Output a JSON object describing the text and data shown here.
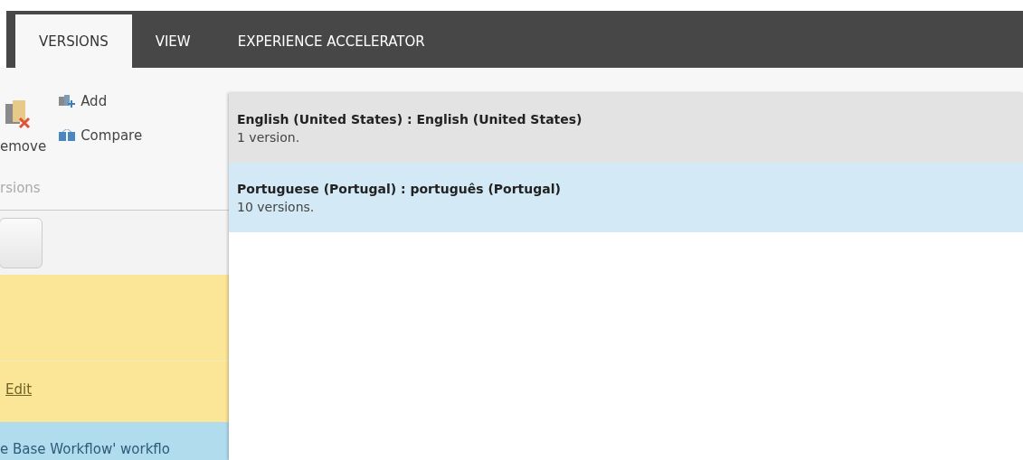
{
  "tabs": [
    {
      "label": "VERSIONS",
      "selected": true
    },
    {
      "label": "VIEW",
      "selected": false
    },
    {
      "label": "EXPERIENCE ACCELERATOR",
      "selected": false
    }
  ],
  "ribbon": {
    "remove_label": "emove",
    "add_label": "Add",
    "compare_label": "Compare",
    "group_label": "rsions"
  },
  "panel": {
    "link": "Edit",
    "workflow_text": "e Base Workflow' workflo"
  },
  "language_menu": [
    {
      "title": "English (United States) : English (United States)",
      "count": "1 version.",
      "selected": false
    },
    {
      "title": "Portuguese (Portugal) : português (Portugal)",
      "count": "10 versions.",
      "selected": true
    }
  ]
}
